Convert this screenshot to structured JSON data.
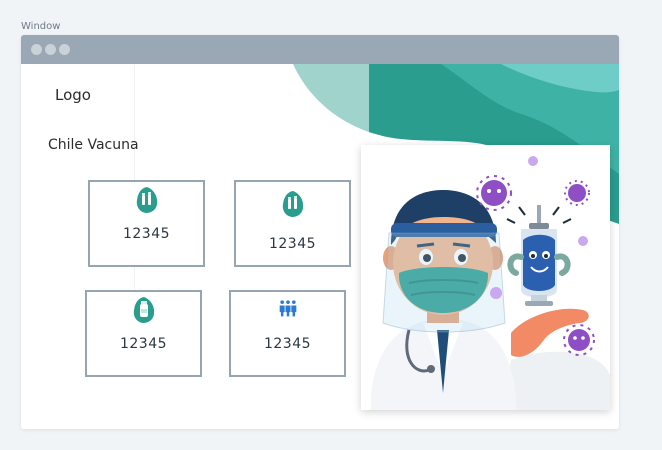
{
  "window": {
    "label": "Window"
  },
  "header": {
    "logo": "Logo",
    "brand": "Chile Vacuna"
  },
  "stats": [
    {
      "value": "12345",
      "icon": "vaccine-vials-icon"
    },
    {
      "value": "12345",
      "icon": "vaccine-vials-icon"
    },
    {
      "value": "12345",
      "icon": "vaccine-bottle-icon"
    },
    {
      "value": "12345",
      "icon": "people-group-icon"
    }
  ],
  "colors": {
    "accent": "#2a9d8f",
    "accent_dark": "#1f7f75",
    "titlebar": "#9aa7b4",
    "card_border": "#97a4b1",
    "virus": "#8e4fc4"
  },
  "illustration": {
    "subject": "doctor-with-vaccine-illustration"
  }
}
